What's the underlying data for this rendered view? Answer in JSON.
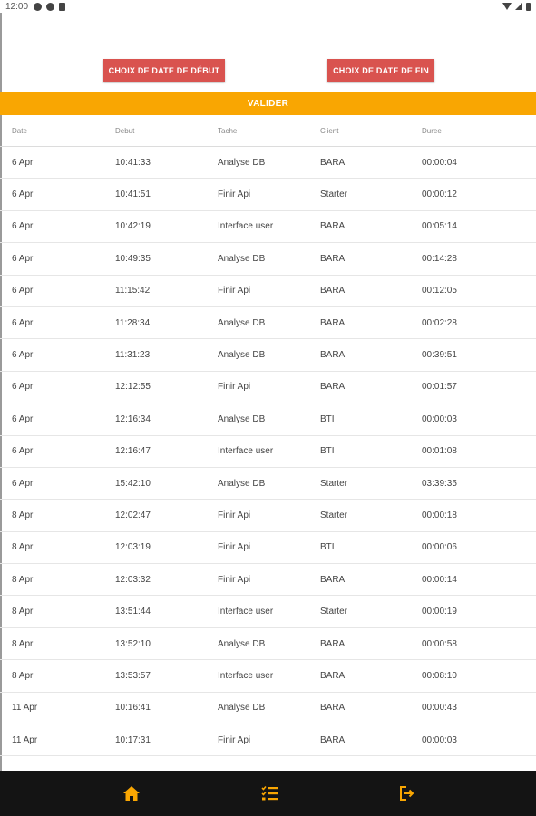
{
  "status_bar": {
    "time": "12:00"
  },
  "buttons": {
    "start_label": "CHOIX DE DATE DE DÉBUT",
    "end_label": "CHOIX DE DATE DE FIN",
    "validate_label": "VALIDER"
  },
  "table": {
    "headers": [
      "Date",
      "Debut",
      "Tache",
      "Client",
      "Duree"
    ],
    "rows": [
      [
        "6 Apr",
        "10:41:33",
        "Analyse DB",
        "BARA",
        "00:00:04"
      ],
      [
        "6 Apr",
        "10:41:51",
        "Finir Api",
        "Starter",
        "00:00:12"
      ],
      [
        "6 Apr",
        "10:42:19",
        "Interface user",
        "BARA",
        "00:05:14"
      ],
      [
        "6 Apr",
        "10:49:35",
        "Analyse DB",
        "BARA",
        "00:14:28"
      ],
      [
        "6 Apr",
        "11:15:42",
        "Finir Api",
        "BARA",
        "00:12:05"
      ],
      [
        "6 Apr",
        "11:28:34",
        "Analyse DB",
        "BARA",
        "00:02:28"
      ],
      [
        "6 Apr",
        "11:31:23",
        "Analyse DB",
        "BARA",
        "00:39:51"
      ],
      [
        "6 Apr",
        "12:12:55",
        "Finir Api",
        "BARA",
        "00:01:57"
      ],
      [
        "6 Apr",
        "12:16:34",
        "Analyse DB",
        "BTI",
        "00:00:03"
      ],
      [
        "6 Apr",
        "12:16:47",
        "Interface user",
        "BTI",
        "00:01:08"
      ],
      [
        "6 Apr",
        "15:42:10",
        "Analyse DB",
        "Starter",
        "03:39:35"
      ],
      [
        "8 Apr",
        "12:02:47",
        "Finir Api",
        "Starter",
        "00:00:18"
      ],
      [
        "8 Apr",
        "12:03:19",
        "Finir Api",
        "BTI",
        "00:00:06"
      ],
      [
        "8 Apr",
        "12:03:32",
        "Finir Api",
        "BARA",
        "00:00:14"
      ],
      [
        "8 Apr",
        "13:51:44",
        "Interface user",
        "Starter",
        "00:00:19"
      ],
      [
        "8 Apr",
        "13:52:10",
        "Analyse DB",
        "BARA",
        "00:00:58"
      ],
      [
        "8 Apr",
        "13:53:57",
        "Interface user",
        "BARA",
        "00:08:10"
      ],
      [
        "11 Apr",
        "10:16:41",
        "Analyse DB",
        "BARA",
        "00:00:43"
      ],
      [
        "11 Apr",
        "10:17:31",
        "Finir Api",
        "BARA",
        "00:00:03"
      ]
    ]
  },
  "bottom_nav": {
    "items": [
      {
        "icon": "home-icon"
      },
      {
        "icon": "task-list-icon"
      },
      {
        "icon": "logout-icon"
      }
    ]
  },
  "colors": {
    "accent": "#f9a602",
    "button_red": "#d9534f",
    "nav_background": "#141414"
  }
}
